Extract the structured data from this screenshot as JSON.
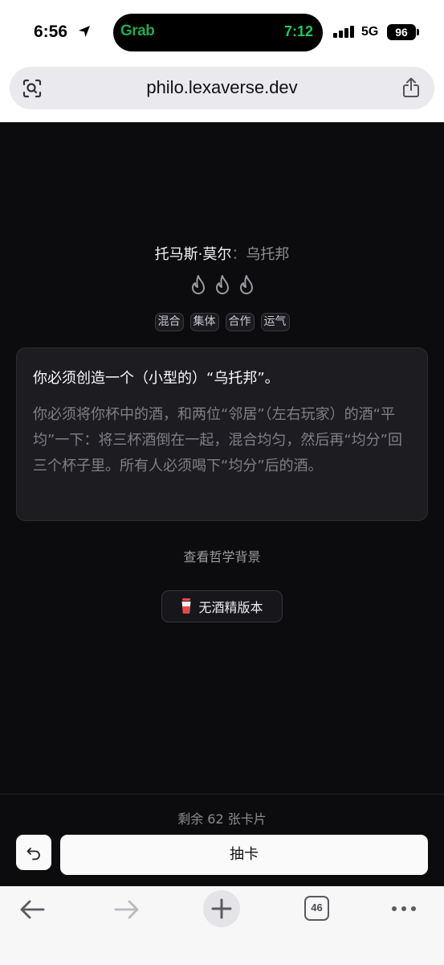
{
  "status_bar": {
    "time": "6:56",
    "island_app": "Grab",
    "island_time": "7:12",
    "network": "5G",
    "battery": "96"
  },
  "browser": {
    "url": "philo.lexaverse.dev",
    "tab_count": "46"
  },
  "card": {
    "author": "托马斯·莫尔",
    "separator": "：",
    "work": "乌托邦",
    "intensity_level": 3,
    "tags": [
      "混合",
      "集体",
      "合作",
      "运气"
    ],
    "title": "你必须创造一个（小型的）“乌托邦”。",
    "body": "你必须将你杯中的酒，和两位“邻居”（左右玩家）的酒“平均”一下：将三杯酒倒在一起，混合均匀，然后再“均分”回三个杯子里。所有人必须喝下“均分”后的酒。"
  },
  "actions": {
    "background_link": "查看哲学背景",
    "non_alcoholic": "无酒精版本",
    "remaining": "剩余 62 张卡片",
    "draw": "抽卡"
  },
  "colors": {
    "background": "#0c0c0f",
    "card": "#1c1c21",
    "grab_green": "#22a94f",
    "island_time_green": "#22c55e"
  }
}
